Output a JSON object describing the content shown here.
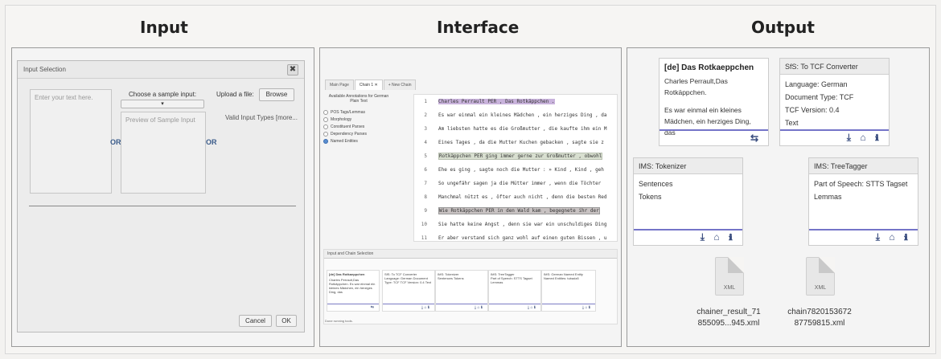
{
  "headings": {
    "input": "Input",
    "interface": "Interface",
    "output": "Output"
  },
  "input_dialog": {
    "title": "Input Selection",
    "close": "✖",
    "text_placeholder": "Enter your text here.",
    "or1": "OR",
    "or2": "OR",
    "sample_label": "Choose a sample input:",
    "preview_placeholder": "Preview of Sample Input",
    "upload_label": "Upload a file:",
    "browse": "Browse",
    "valid_types": "Valid Input Types [more...",
    "cancel": "Cancel",
    "ok": "OK"
  },
  "interface": {
    "tabs": [
      "Main Page",
      "Chain 1 ✕",
      "+ New Chain"
    ],
    "annotations_title": "Available Annotations for German Plain Text",
    "annotations": [
      "POS Tags/Lemmas",
      "Morphology",
      "Constituent Parses",
      "Dependency Parses",
      "Named Entities"
    ],
    "selected_annotation": 4,
    "lines": [
      {
        "no": "1",
        "text": "Charles Perrault PER , Das Rotkäppchen ."
      },
      {
        "no": "2",
        "text": "Es war einmal ein kleines Mädchen , ein herziges Ding , da"
      },
      {
        "no": "3",
        "text": "Am liebsten hatte es die Großmutter , die kaufte ihm ein M"
      },
      {
        "no": "4",
        "text": "Eines Tages , da die Mutter Kuchen gebacken , sagte sie z"
      },
      {
        "no": "5",
        "text": "Rotkäppchen PER ging immer gerne zur Großmutter , obwohl"
      },
      {
        "no": "6",
        "text": "Ehe es ging , sagte noch die Mutter : » Kind , Kind , geh"
      },
      {
        "no": "7",
        "text": "So ungefähr sagen ja die Mütter immer , wenn die Töchter"
      },
      {
        "no": "8",
        "text": "Manchmal nützt es , öfter auch nicht , denn die besten Red"
      },
      {
        "no": "9",
        "text": "Wie Rotkäppchen PER in den Wald kam , begegnete ihr der"
      },
      {
        "no": "10",
        "text": "Sie hatte keine Angst , denn sie war ein unschuldiges Ding"
      },
      {
        "no": "11",
        "text": "Er aber verstand sich ganz wohl auf einen guten Bissen , u"
      }
    ],
    "chain_header": "Input and Chain Selection",
    "mini_cards": [
      {
        "title": "[de] Das Rotkaeppchen",
        "body": "Charles Perrault,Das Rotkäppchen. Es war einmal ein kleines Mädchen, ein herziges Ding, das"
      },
      {
        "title": "SfS: To TCF Converter",
        "body": "Language: German Document Type: TCF TCF Version: 0.4 Text"
      },
      {
        "title": "IMS: Tokenizer",
        "body": "Sentences Tokens"
      },
      {
        "title": "IMS: TreeTagger",
        "body": "Part of Speech: STTS Tagset Lemmas"
      },
      {
        "title": "IMS: German Named Entity",
        "body": "Named Entities: tubadz8"
      }
    ],
    "status": "Done running tools."
  },
  "output": {
    "source_card": {
      "title": "[de] Das Rotkaeppchen",
      "lines": [
        "Charles Perrault,Das",
        "Rotkäppchen.",
        "",
        "Es war einmal ein kleines",
        "Mädchen, ein herziges Ding, das"
      ],
      "icon": "swap-icon"
    },
    "tcf_card": {
      "title": "SfS: To TCF Converter",
      "lines": [
        "Language: German",
        "Document Type: TCF",
        "TCF Version: 0.4",
        "Text"
      ]
    },
    "tokenizer_card": {
      "title": "IMS: Tokenizer",
      "lines": [
        "Sentences",
        "Tokens"
      ]
    },
    "treetagger_card": {
      "title": "IMS: TreeTagger",
      "lines": [
        "Part of Speech: STTS Tagset",
        "Lemmas"
      ]
    },
    "card_icons": "⤓ ⌂ ℹ",
    "files": [
      {
        "label": "XML",
        "name1": "chainer_result_71",
        "name2": "855095...945.xml"
      },
      {
        "label": "XML",
        "name1": "chain7820153672",
        "name2": "87759815.xml"
      }
    ]
  }
}
